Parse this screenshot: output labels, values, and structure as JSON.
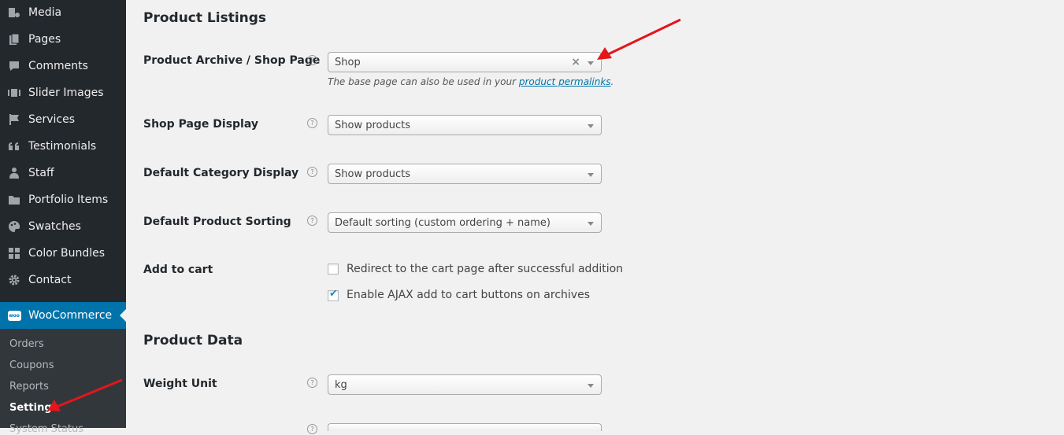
{
  "sidebar": {
    "items": [
      {
        "label": "Media",
        "icon": "media-icon"
      },
      {
        "label": "Pages",
        "icon": "pages-icon"
      },
      {
        "label": "Comments",
        "icon": "comments-icon"
      },
      {
        "label": "Slider Images",
        "icon": "slider-icon"
      },
      {
        "label": "Services",
        "icon": "flag-icon"
      },
      {
        "label": "Testimonials",
        "icon": "quote-icon"
      },
      {
        "label": "Staff",
        "icon": "person-icon"
      },
      {
        "label": "Portfolio Items",
        "icon": "folder-icon"
      },
      {
        "label": "Swatches",
        "icon": "palette-icon"
      },
      {
        "label": "Color Bundles",
        "icon": "grid-icon"
      },
      {
        "label": "Contact",
        "icon": "gear-icon"
      }
    ],
    "active": {
      "label": "WooCommerce",
      "icon": "woo-icon",
      "badge": "woo"
    },
    "submenu": [
      "Orders",
      "Coupons",
      "Reports",
      "Settings",
      "System Status"
    ]
  },
  "main": {
    "section1_title": "Product Listings",
    "shop_page": {
      "label": "Product Archive / Shop Page",
      "value": "Shop",
      "clear": "×",
      "desc_prefix": "The base page can also be used in your ",
      "desc_link": "product permalinks",
      "desc_suffix": "."
    },
    "shop_display": {
      "label": "Shop Page Display",
      "value": "Show products"
    },
    "category_display": {
      "label": "Default Category Display",
      "value": "Show products"
    },
    "sorting": {
      "label": "Default Product Sorting",
      "value": "Default sorting (custom ordering + name)"
    },
    "add_to_cart": {
      "label": "Add to cart",
      "redirect": {
        "label": "Redirect to the cart page after successful addition",
        "checked": false
      },
      "ajax": {
        "label": "Enable AJAX add to cart buttons on archives",
        "checked": true,
        "tick": "✔"
      }
    },
    "section2_title": "Product Data",
    "weight": {
      "label": "Weight Unit",
      "value": "kg"
    },
    "help_glyph": "?"
  },
  "colors": {
    "sidebar": "#23282d",
    "active": "#0073aa",
    "annotation": "#e3161c"
  }
}
